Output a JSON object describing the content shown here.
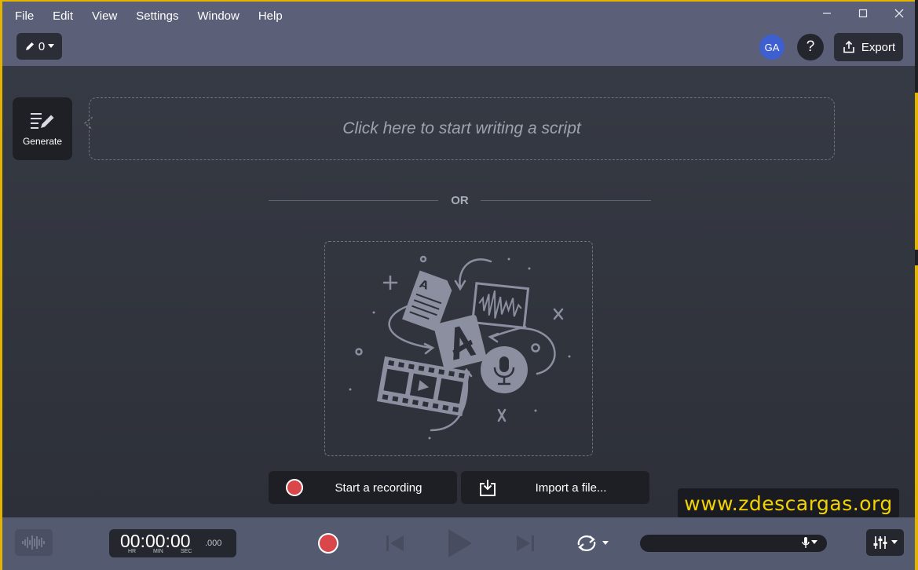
{
  "menu": {
    "items": [
      "File",
      "Edit",
      "View",
      "Settings",
      "Window",
      "Help"
    ]
  },
  "window_controls": {
    "minimize": "—",
    "maximize": "☐",
    "close": "✕"
  },
  "toolbar": {
    "annotation_count": "0",
    "avatar_initials": "GA",
    "help_label": "?",
    "export_label": "Export"
  },
  "main": {
    "generate_label": "Generate",
    "script_placeholder": "Click here to start writing a script",
    "or_label": "OR",
    "start_recording_label": "Start a recording",
    "import_file_label": "Import a file..."
  },
  "watermark": {
    "text": "www.zdescargas.org"
  },
  "transport": {
    "time": "00:00:00",
    "milliseconds": ".000",
    "unit_hr": "HR",
    "unit_min": "MIN",
    "unit_sec": "SEC"
  },
  "colors": {
    "accent_yellow": "#e2b400",
    "record_red": "#d9474a",
    "avatar_blue": "#3d5fd0",
    "menubar": "#5b6078"
  }
}
